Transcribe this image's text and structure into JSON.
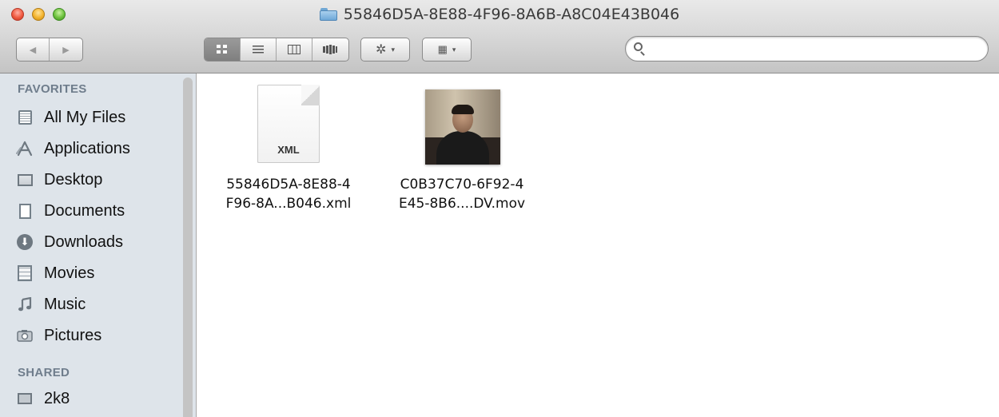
{
  "window": {
    "title": "55846D5A-8E88-4F96-8A6B-A8C04E43B046"
  },
  "toolbar": {
    "back_icon": "◀",
    "forward_icon": "▶",
    "view_icons": [
      "icon-view",
      "list-view",
      "column-view",
      "coverflow-view"
    ],
    "action_icon": "✲",
    "arrange_icon": "▦",
    "caret": "▾"
  },
  "search": {
    "value": "",
    "placeholder": ""
  },
  "sidebar": {
    "favorites_header": "FAVORITES",
    "items": [
      {
        "label": "All My Files",
        "icon": "all-files-icon"
      },
      {
        "label": "Applications",
        "icon": "applications-icon"
      },
      {
        "label": "Desktop",
        "icon": "desktop-icon"
      },
      {
        "label": "Documents",
        "icon": "documents-icon"
      },
      {
        "label": "Downloads",
        "icon": "downloads-icon"
      },
      {
        "label": "Movies",
        "icon": "movies-icon"
      },
      {
        "label": "Music",
        "icon": "music-icon"
      },
      {
        "label": "Pictures",
        "icon": "pictures-icon"
      }
    ],
    "shared_header": "SHARED",
    "shared_items": [
      {
        "label": "2k8",
        "icon": "computer-icon"
      }
    ]
  },
  "files": [
    {
      "name_line1": "55846D5A-8E88-4",
      "name_line2": "F96-8A...B046.xml",
      "badge": "XML",
      "type": "xml"
    },
    {
      "name_line1": "C0B37C70-6F92-4",
      "name_line2": "E45-8B6....DV.mov",
      "type": "video"
    }
  ]
}
